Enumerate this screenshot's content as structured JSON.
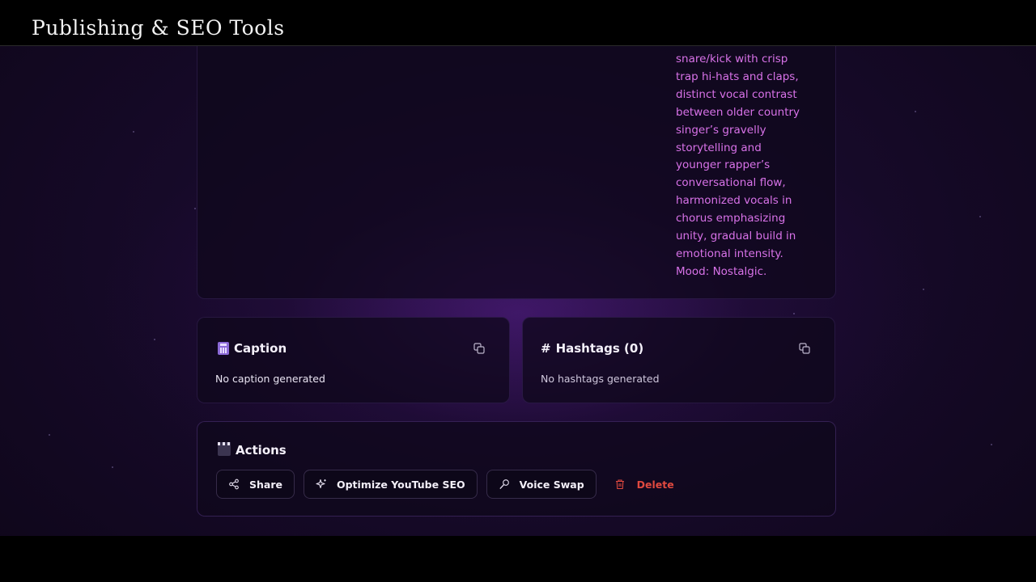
{
  "topbar": {
    "title": "Publishing & SEO Tools"
  },
  "description": {
    "lines": [
      "snare/kick with crisp",
      "trap hi-hats and claps,",
      "distinct vocal contrast",
      "between older country",
      "singer’s gravelly",
      "storytelling and",
      "younger rapper’s",
      "conversational flow,",
      "harmonized vocals in",
      "chorus emphasizing",
      "unity, gradual build in",
      "emotional intensity.",
      "Mood: Nostalgic."
    ]
  },
  "caption": {
    "icon": "calculator-icon",
    "title": "Caption",
    "body": "No caption generated"
  },
  "hashtags": {
    "prefix": "#",
    "title": "Hashtags (0)",
    "body": "No hashtags generated"
  },
  "actions": {
    "icon": "clapperboard-icon",
    "title": "Actions",
    "buttons": [
      {
        "label": "Share",
        "icon": "share-icon"
      },
      {
        "label": "Optimize YouTube SEO",
        "icon": "sparkles-icon"
      },
      {
        "label": "Voice Swap",
        "icon": "microphone-icon"
      },
      {
        "label": "Delete",
        "icon": "trash-icon"
      }
    ]
  },
  "colors": {
    "accent": "#d872e8",
    "danger": "#e0493f"
  }
}
